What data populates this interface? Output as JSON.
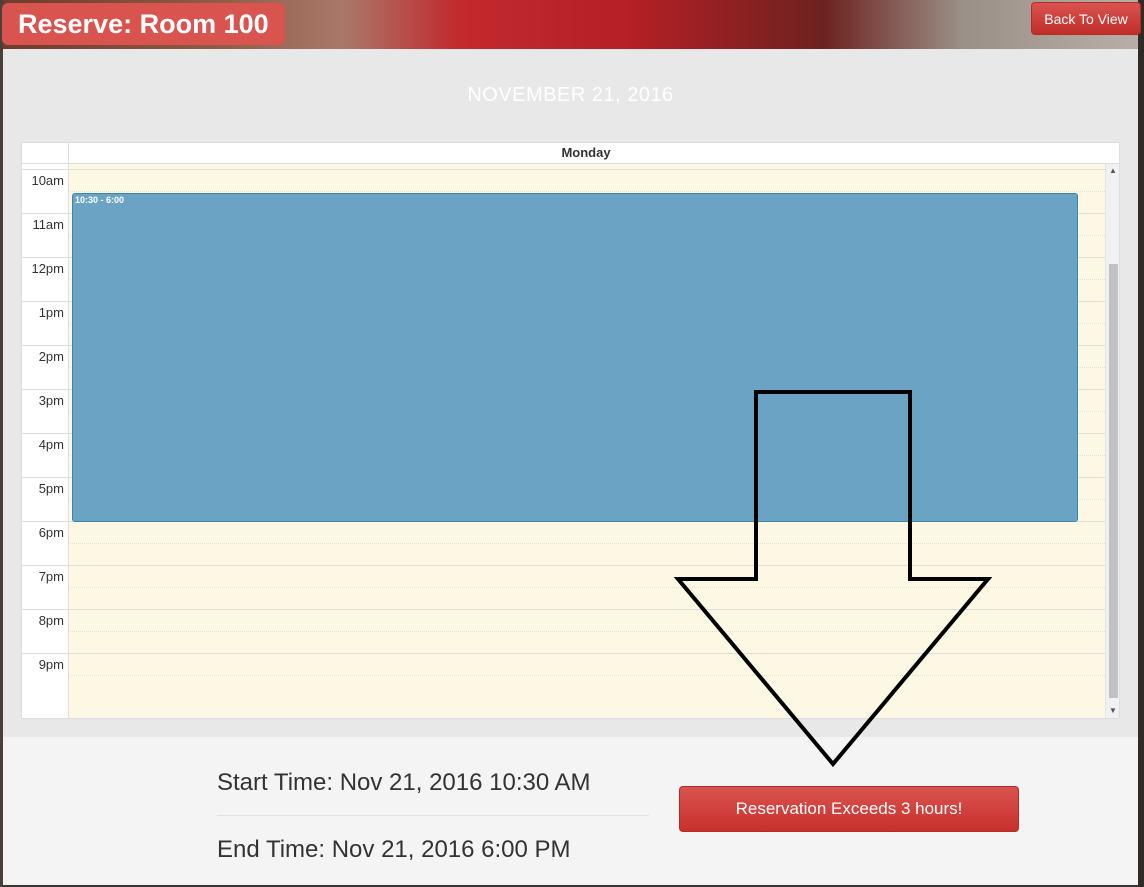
{
  "header": {
    "title": "Reserve: Room 100",
    "back_button": "Back To View"
  },
  "date_heading": "NOVEMBER 21, 2016",
  "calendar": {
    "day_label": "Monday",
    "hours": [
      "10am",
      "11am",
      "12pm",
      "1pm",
      "2pm",
      "3pm",
      "4pm",
      "5pm",
      "6pm",
      "7pm",
      "8pm",
      "9pm"
    ],
    "event": {
      "time_label": "10:30 - 6:00",
      "color": "#6aa3c3"
    },
    "slot_color": "#fcf8e3",
    "scroll_up_icon": "▲",
    "scroll_down_icon": "▼"
  },
  "reservation": {
    "start_time": "Start Time: Nov 21, 2016 10:30 AM",
    "end_time": "End Time: Nov 21, 2016 6:00 PM",
    "exceeds_button": "Reservation Exceeds 3 hours!",
    "button_color": "#d9534f"
  },
  "annotation": {
    "icon": "down-arrow-icon"
  }
}
